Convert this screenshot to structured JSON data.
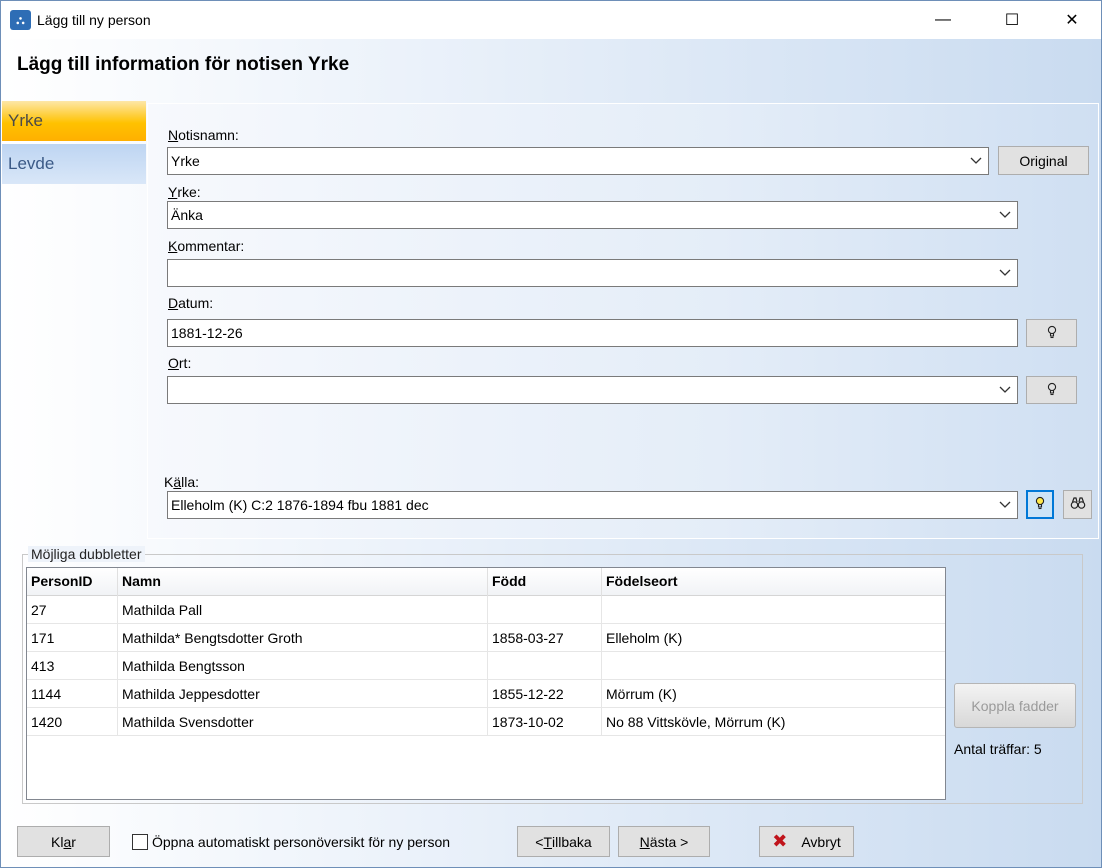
{
  "window": {
    "title": "Lägg till ny person",
    "minimize_glyph": "—",
    "maximize_glyph": "☐",
    "close_glyph": "✕"
  },
  "heading": "Lägg till information för notisen Yrke",
  "sidebar": {
    "items": [
      {
        "label": "Yrke",
        "active": true
      },
      {
        "label": "Levde",
        "active": false
      }
    ]
  },
  "form": {
    "notisnamn": {
      "label_first": "N",
      "label_rest": "otisnamn:",
      "value": "Yrke"
    },
    "original_button": "Original",
    "yrke": {
      "label_first": "Y",
      "label_rest": "rke:",
      "value": "Änka"
    },
    "kommentar": {
      "label_first": "K",
      "label_rest": "ommentar:",
      "value": ""
    },
    "datum": {
      "label_first": "D",
      "label_rest": "atum:",
      "value": "1881-12-26"
    },
    "ort": {
      "label_first": "O",
      "label_rest": "rt:",
      "value": ""
    },
    "kalla": {
      "label_pre": "K",
      "label_u": "ä",
      "label_rest": "lla:",
      "value": "Elleholm (K) C:2 1876-1894 fbu 1881 dec"
    }
  },
  "icons": {
    "bulb": "💡",
    "chevron": "⌄",
    "binoculars": "⊗"
  },
  "duplicates": {
    "group_label": "Möjliga dubbletter",
    "columns": [
      "PersonID",
      "Namn",
      "Född",
      "Födelseort"
    ],
    "rows": [
      [
        "27",
        "Mathilda Pall",
        "",
        ""
      ],
      [
        "171",
        "Mathilda* Bengtsdotter Groth",
        "1858-03-27",
        "Elleholm (K)"
      ],
      [
        "413",
        "Mathilda Bengtsson",
        "",
        ""
      ],
      [
        "1144",
        "Mathilda Jeppesdotter",
        "1855-12-22",
        "Mörrum (K)"
      ],
      [
        "1420",
        "Mathilda Svensdotter",
        "1873-10-02",
        "No 88 Vittskövle, Mörrum (K)"
      ]
    ],
    "koppla_button": "Koppla fadder",
    "hits_label": "Antal träffar: 5"
  },
  "footer": {
    "klar_pre": "Kl",
    "klar_u": "a",
    "klar_rest": "r",
    "checkbox_label": "Öppna automatiskt personöversikt för ny person",
    "tillbaka_pre": "< ",
    "tillbaka_u": "T",
    "tillbaka_rest": "illbaka",
    "nasta_u": "N",
    "nasta_rest": "ästa >",
    "avbryt_icon": "✖",
    "avbryt": "Avbryt"
  }
}
